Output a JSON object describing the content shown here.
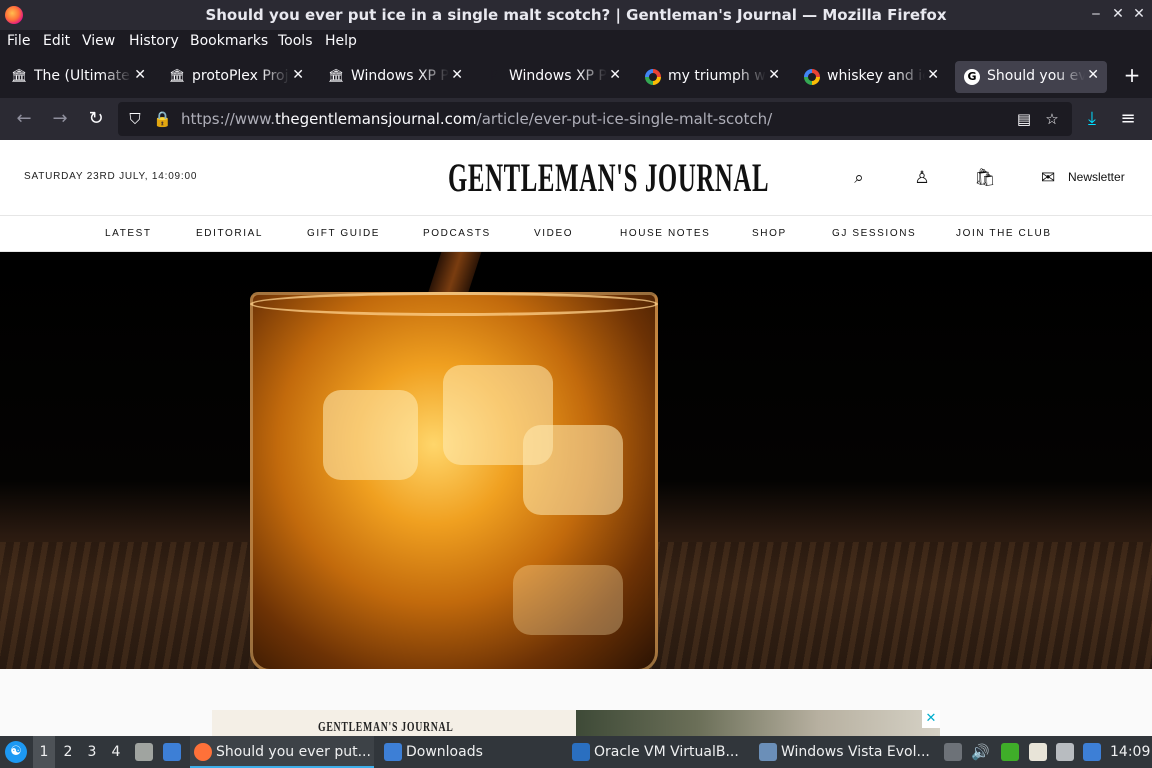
{
  "window": {
    "title": "Should you ever put ice in a single malt scotch? | Gentleman's Journal — Mozilla Firefox",
    "minimize": "‒",
    "maximize": "✕",
    "close": "✕"
  },
  "menu": [
    "File",
    "Edit",
    "View",
    "History",
    "Bookmarks",
    "Tools",
    "Help"
  ],
  "tabs": [
    {
      "label": "The (Ultimate?) Windows XP",
      "icon": "archive-icon",
      "active": false
    },
    {
      "label": "protoPlex Project",
      "icon": "archive-icon",
      "active": false
    },
    {
      "label": "Windows XP Professional",
      "icon": "archive-icon",
      "active": false
    },
    {
      "label": "Windows XP Pro",
      "icon": "pinterest-icon",
      "active": false
    },
    {
      "label": "my triumph with ice",
      "icon": "google-icon",
      "active": false
    },
    {
      "label": "whiskey and ice",
      "icon": "google-icon",
      "active": false
    },
    {
      "label": "Should you ever put ice",
      "icon": "gj-icon",
      "active": true
    }
  ],
  "nav": {
    "url_prefix": "https://www.",
    "url_domain": "thegentlemansjournal.com",
    "url_path": "/article/ever-put-ice-single-malt-scotch/"
  },
  "site": {
    "date": "SATURDAY 23RD JULY, 14:09:00",
    "logo": "GENTLEMAN'S JOURNAL",
    "newsletter": "Newsletter",
    "nav_items": [
      "LATEST",
      "EDITORIAL",
      "GIFT GUIDE",
      "PODCASTS",
      "VIDEO",
      "HOUSE NOTES",
      "SHOP",
      "GJ SESSIONS",
      "JOIN THE CLUB"
    ],
    "ad_text": "GENTLEMAN'S JOURNAL",
    "ad_close": "✕"
  },
  "taskbar": {
    "desktops": [
      "1",
      "2",
      "3",
      "4"
    ],
    "tasks": [
      {
        "label": "Should you ever put...",
        "active": true,
        "color": "#ff7139"
      },
      {
        "label": "Downloads",
        "active": false,
        "color": "#3d7fd6"
      },
      {
        "label": "Oracle VM VirtualB...",
        "active": false,
        "color": "#2a6fc0"
      },
      {
        "label": "Windows Vista Evol...",
        "active": false,
        "color": "#6b8fb8"
      }
    ],
    "clock": "14:09"
  }
}
